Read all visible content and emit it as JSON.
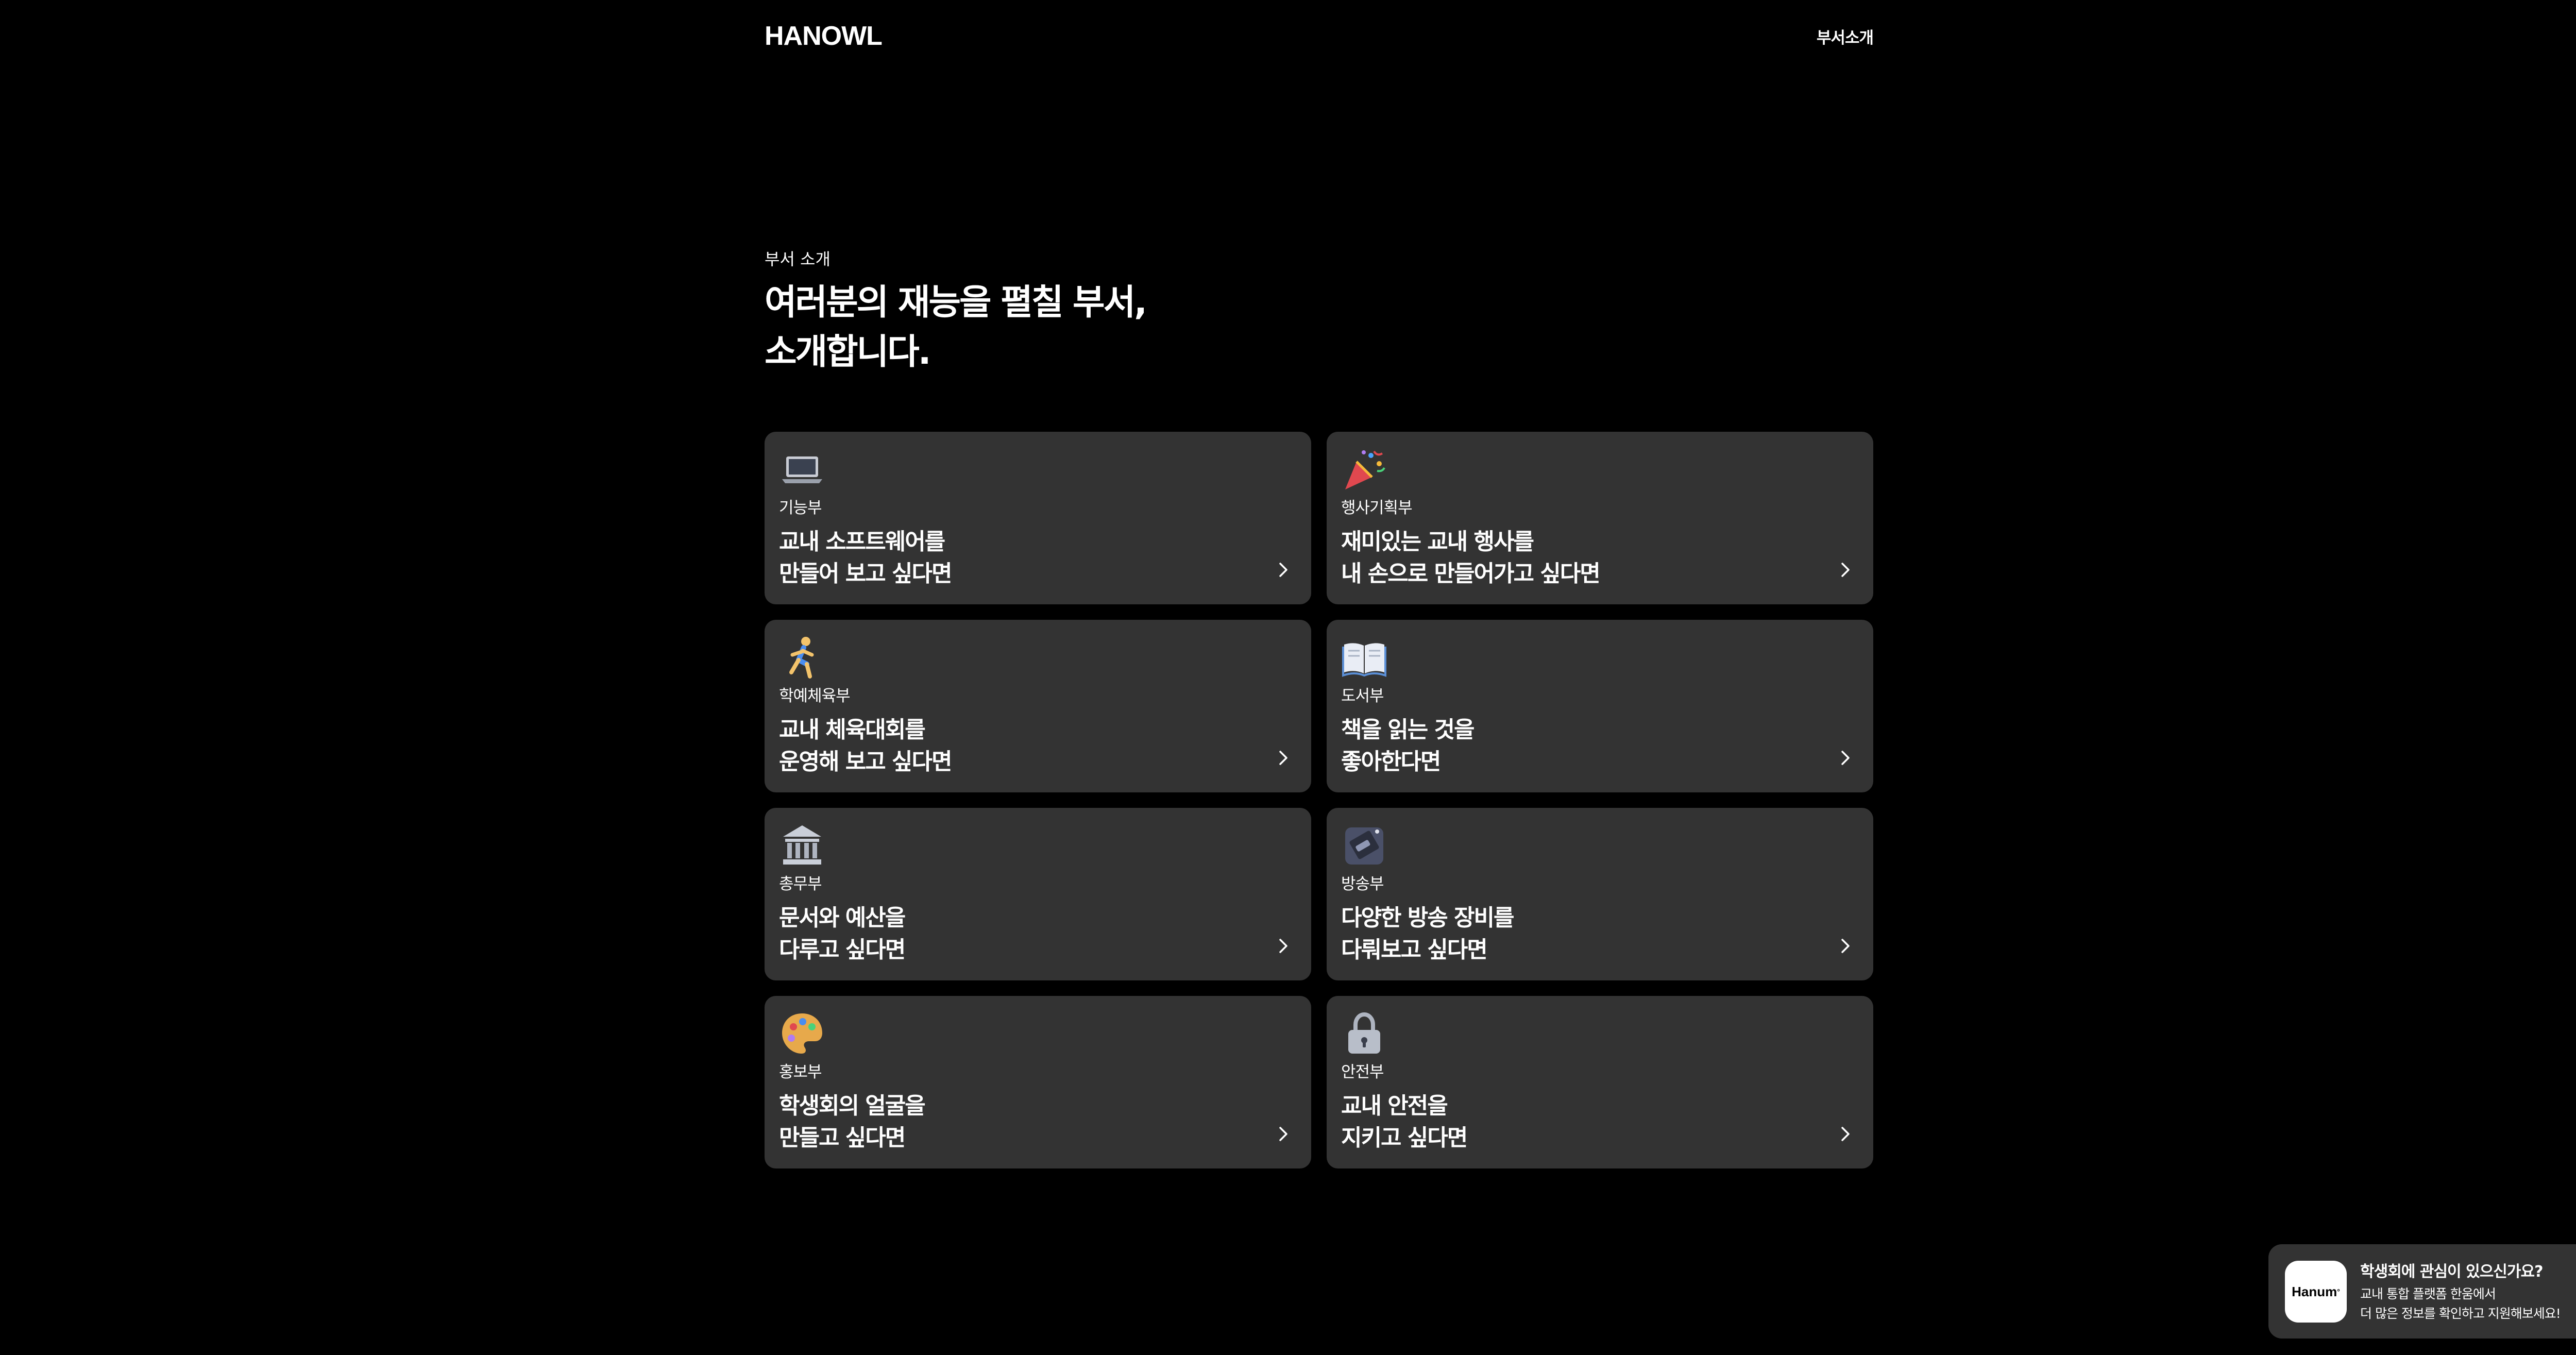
{
  "header": {
    "logo": "HANOWL",
    "nav_link": "부서소개"
  },
  "intro": {
    "label": "부서 소개",
    "headline_line1": "여러분의 재능을 펼칠 부서,",
    "headline_line2": "소개합니다."
  },
  "departments": [
    {
      "name": "기능부",
      "desc_line1": "교내 소프트웨어를",
      "desc_line2": "만들어 보고 싶다면",
      "icon": "laptop-icon"
    },
    {
      "name": "행사기획부",
      "desc_line1": "재미있는 교내 행사를",
      "desc_line2": "내 손으로 만들어가고 싶다면",
      "icon": "party-popper-icon"
    },
    {
      "name": "학예체육부",
      "desc_line1": "교내 체육대회를",
      "desc_line2": "운영해 보고 싶다면",
      "icon": "running-icon"
    },
    {
      "name": "도서부",
      "desc_line1": "책을 읽는 것을",
      "desc_line2": "좋아한다면",
      "icon": "open-book-icon"
    },
    {
      "name": "총무부",
      "desc_line1": "문서와 예산을",
      "desc_line2": "다루고 싶다면",
      "icon": "bank-icon"
    },
    {
      "name": "방송부",
      "desc_line1": "다양한 방송 장비를",
      "desc_line2": "다뤄보고 싶다면",
      "icon": "broadcast-icon"
    },
    {
      "name": "홍보부",
      "desc_line1": "학생회의 얼굴을",
      "desc_line2": "만들고 싶다면",
      "icon": "palette-icon"
    },
    {
      "name": "안전부",
      "desc_line1": "교내 안전을",
      "desc_line2": "지키고 싶다면",
      "icon": "lock-icon"
    }
  ],
  "toast": {
    "logo_text": "Hanum",
    "title": "학생회에 관심이 있으신가요?",
    "body_line1": "교내 통합 플랫폼 한움에서",
    "body_line2": "더 많은 정보를 확인하고 지원해보세요!"
  },
  "colors": {
    "background": "#000000",
    "card": "#333333",
    "text": "#ffffff"
  }
}
